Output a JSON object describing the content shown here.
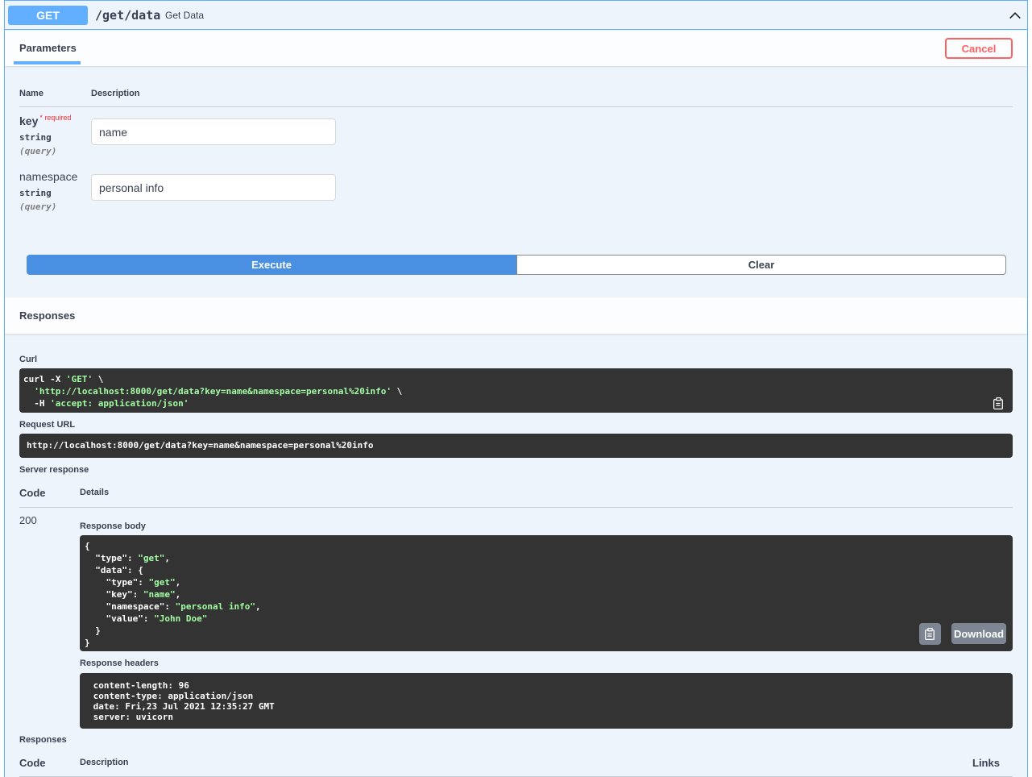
{
  "summary": {
    "method": "GET",
    "path": "/get/data",
    "description": "Get Data"
  },
  "parameters": {
    "tab_label": "Parameters",
    "cancel_label": "Cancel",
    "col_name": "Name",
    "col_description": "Description",
    "items": [
      {
        "name": "key",
        "required_mark": "*",
        "required_label": "required",
        "type": "string",
        "in": "(query)",
        "value": "name"
      },
      {
        "name": "namespace",
        "type": "string",
        "in": "(query)",
        "value": "personal info"
      }
    ],
    "execute_label": "Execute",
    "clear_label": "Clear"
  },
  "responses": {
    "title": "Responses",
    "curl_label": "Curl",
    "curl_lines": [
      {
        "plain": "curl -X ",
        "str": "'GET'",
        "after": " \\"
      },
      {
        "plain": "  ",
        "str": "'http://localhost:8000/get/data?key=name&namespace=personal%20info'",
        "after": " \\"
      },
      {
        "plain": "  -H ",
        "str": "'accept: application/json'",
        "after": ""
      }
    ],
    "request_url_label": "Request URL",
    "request_url": "http://localhost:8000/get/data?key=name&namespace=personal%20info",
    "server_response_label": "Server response",
    "col_code": "Code",
    "col_details": "Details",
    "status_code": "200",
    "response_body_label": "Response body",
    "response_body": [
      {
        "k": "",
        "v": "",
        "raw": "{"
      },
      {
        "ind": "  ",
        "k": "\"type\"",
        "v": "\"get\"",
        "tail": ","
      },
      {
        "ind": "  ",
        "k": "\"data\"",
        "raw2": ": {"
      },
      {
        "ind": "    ",
        "k": "\"type\"",
        "v": "\"get\"",
        "tail": ","
      },
      {
        "ind": "    ",
        "k": "\"key\"",
        "v": "\"name\"",
        "tail": ","
      },
      {
        "ind": "    ",
        "k": "\"namespace\"",
        "v": "\"personal info\"",
        "tail": ","
      },
      {
        "ind": "    ",
        "k": "\"value\"",
        "v": "\"John Doe\"",
        "tail": ""
      },
      {
        "raw": "  }"
      },
      {
        "raw": "}"
      }
    ],
    "download_label": "Download",
    "response_headers_label": "Response headers",
    "response_headers": [
      " content-length: 96 ",
      " content-type: application/json ",
      " date: Fri,23 Jul 2021 12:35:27 GMT ",
      " server: uvicorn "
    ],
    "footer_label": "Responses",
    "footer_col_code": "Code",
    "footer_col_description": "Description",
    "footer_col_links": "Links"
  },
  "colors": {
    "get_accent": "#61affe",
    "execute": "#4990e2",
    "cancel": "#ff6060",
    "code_bg": "#333333",
    "code_string": "#a2fca2"
  }
}
